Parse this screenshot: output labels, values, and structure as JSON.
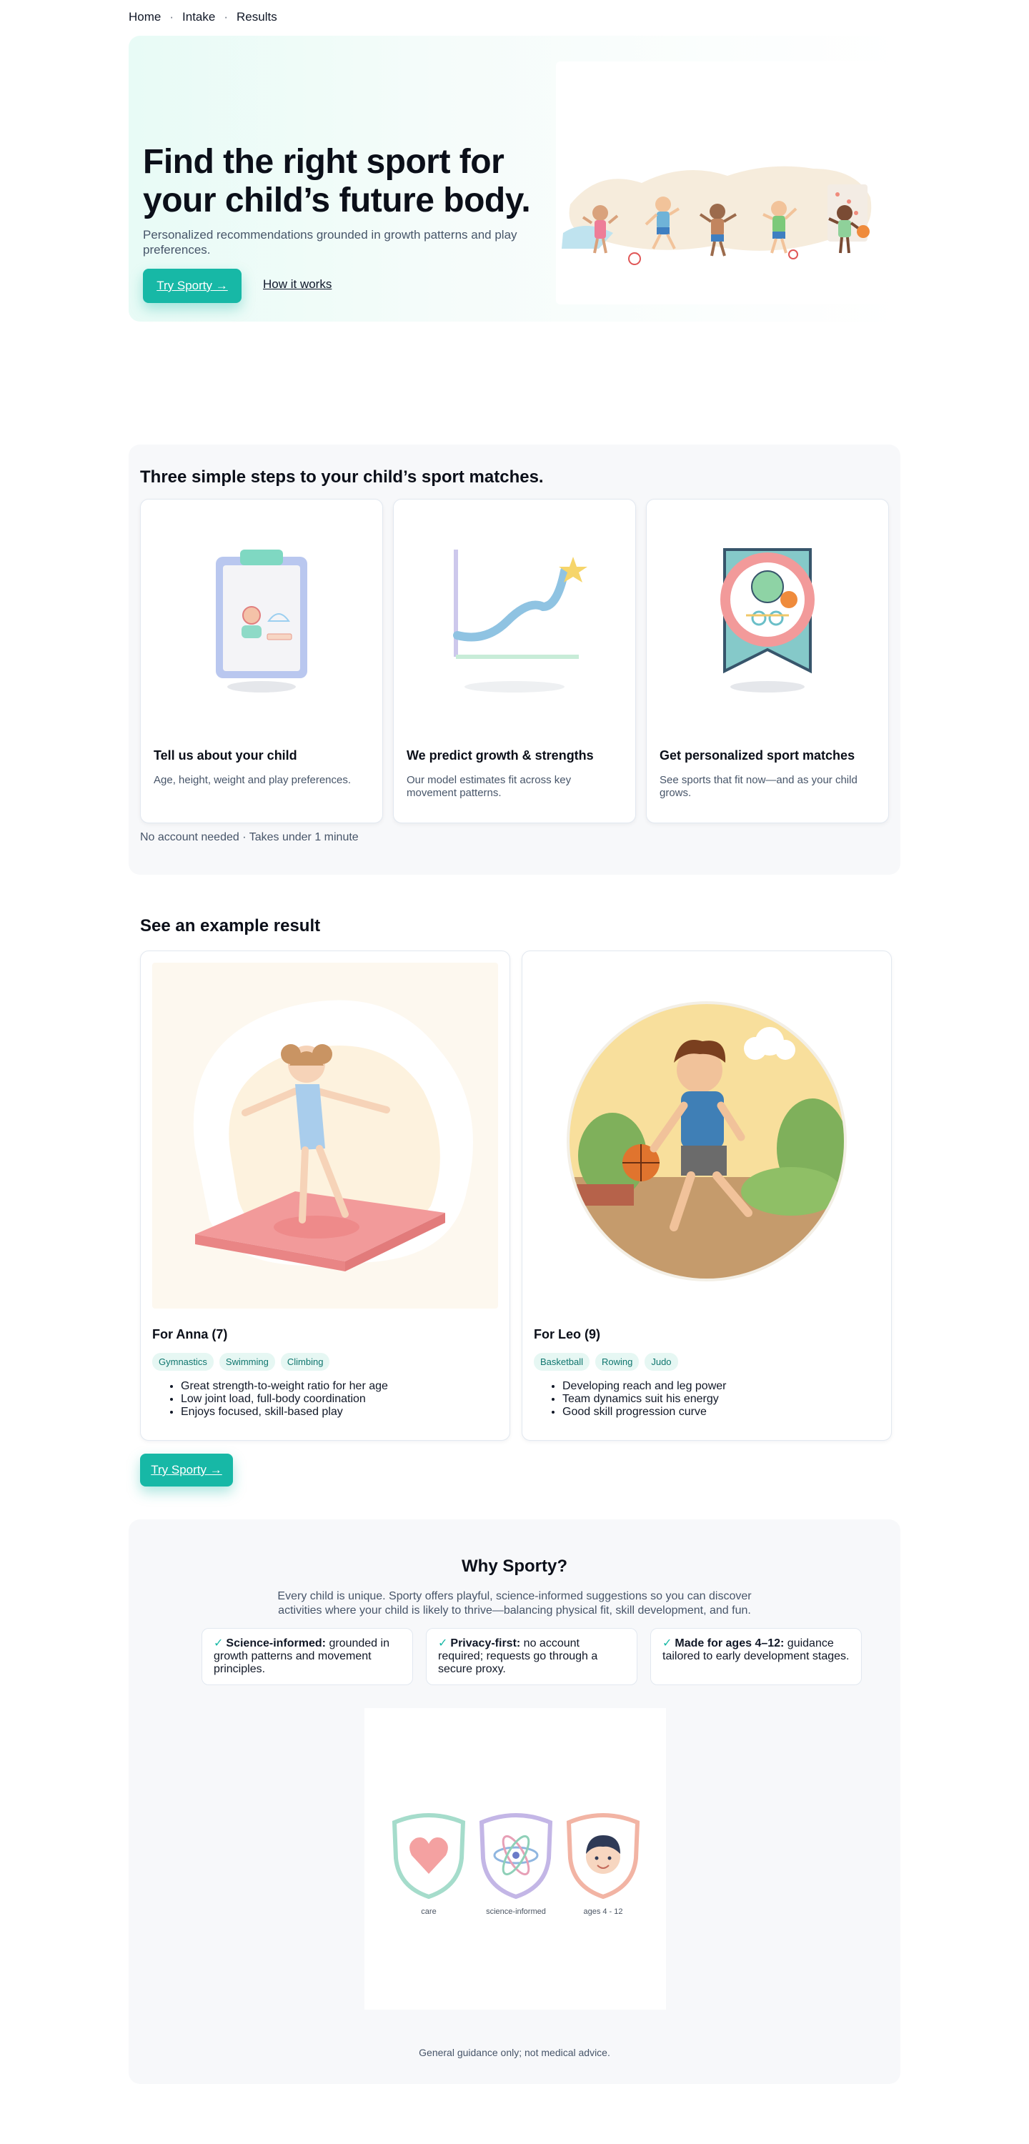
{
  "nav": {
    "items": [
      "Home",
      "Intake",
      "Results"
    ],
    "separator": "·"
  },
  "hero": {
    "title": "Find the right sport for your child’s future body.",
    "subtitle": "Personalized recommendations grounded in growth patterns and play preferences.",
    "cta_label": "Try Sporty →",
    "link_label": "How it works"
  },
  "steps": {
    "heading": "Three simple steps to your child’s sport matches.",
    "items": [
      {
        "title": "Tell us about your child",
        "desc": "Age, height, weight and play preferences.",
        "icon": "clipboard-icon"
      },
      {
        "title": "We predict growth & strengths",
        "desc": "Our model estimates fit across key movement patterns.",
        "icon": "growth-chart-icon"
      },
      {
        "title": "Get personalized sport matches",
        "desc": "See sports that fit now—and as your child grows.",
        "icon": "sport-badge-icon"
      }
    ],
    "note": "No account needed · Takes under 1 minute"
  },
  "example": {
    "heading": "See an example result",
    "cards": [
      {
        "title": "For Anna (7)",
        "tags": [
          "Gymnastics",
          "Swimming",
          "Climbing"
        ],
        "points": [
          "Great strength-to-weight ratio for her age",
          "Low joint load, full-body coordination",
          "Enjoys focused, skill-based play"
        ]
      },
      {
        "title": "For Leo (9)",
        "tags": [
          "Basketball",
          "Rowing",
          "Judo"
        ],
        "points": [
          "Developing reach and leg power",
          "Team dynamics suit his energy",
          "Good skill progression curve"
        ]
      }
    ],
    "cta_label": "Try Sporty →"
  },
  "why": {
    "heading": "Why Sporty?",
    "desc": "Every child is unique. Sporty offers playful, science-informed suggestions so you can discover activities where your child is likely to thrive—balancing physical fit, skill development, and fun.",
    "features": [
      {
        "bold": "Science-informed:",
        "text": " grounded in growth patterns and movement principles."
      },
      {
        "bold": "Privacy-first:",
        "text": " no account required; requests go through a secure proxy."
      },
      {
        "bold": "Made for ages 4–12:",
        "text": " guidance tailored to early development stages."
      }
    ],
    "check_mark": "✓",
    "badges": [
      "care",
      "science-informed",
      "ages 4 - 12"
    ],
    "footer": "General guidance only; not medical advice."
  },
  "colors": {
    "accent": "#17b8a6",
    "tag_bg": "#e6f7f3",
    "tag_text": "#0f766e",
    "section_bg": "#f7f8fa"
  }
}
